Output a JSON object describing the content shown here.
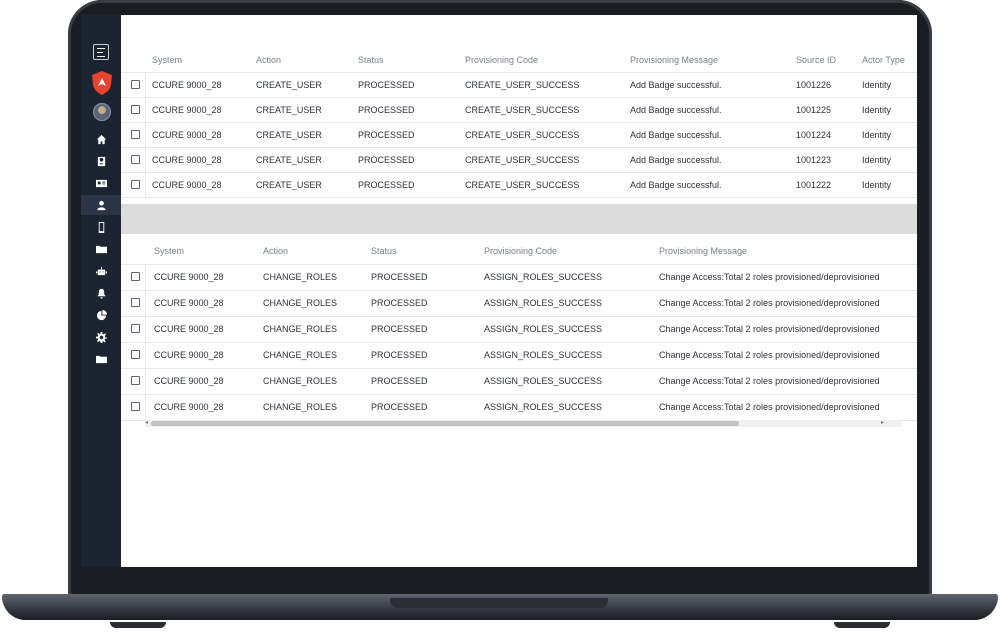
{
  "sidebar": {
    "menu_icon": "hamburger-menu-icon",
    "logo_icon": "shield-logo-icon",
    "avatar": "user-avatar",
    "nav_items": [
      {
        "icon": "home-icon"
      },
      {
        "icon": "id-badge-icon"
      },
      {
        "icon": "id-card-icon"
      },
      {
        "icon": "user-icon",
        "active": true
      },
      {
        "icon": "mobile-icon"
      },
      {
        "icon": "folder-icon"
      },
      {
        "icon": "robot-icon"
      },
      {
        "icon": "bell-icon"
      },
      {
        "icon": "pie-chart-icon"
      },
      {
        "icon": "settings-gear-icon"
      },
      {
        "icon": "folder-icon"
      }
    ],
    "accent_color": "#e8432f"
  },
  "table_top": {
    "headers": [
      "System",
      "Action",
      "Status",
      "Provisioning Code",
      "Provisioning Message",
      "Source ID",
      "Actor Type"
    ],
    "rows": [
      [
        "CCURE 9000_28",
        "CREATE_USER",
        "PROCESSED",
        "CREATE_USER_SUCCESS",
        "Add Badge successful.",
        "1001226",
        "Identity"
      ],
      [
        "CCURE 9000_28",
        "CREATE_USER",
        "PROCESSED",
        "CREATE_USER_SUCCESS",
        "Add Badge successful.",
        "1001225",
        "Identity"
      ],
      [
        "CCURE 9000_28",
        "CREATE_USER",
        "PROCESSED",
        "CREATE_USER_SUCCESS",
        "Add Badge successful.",
        "1001224",
        "Identity"
      ],
      [
        "CCURE 9000_28",
        "CREATE_USER",
        "PROCESSED",
        "CREATE_USER_SUCCESS",
        "Add Badge successful.",
        "1001223",
        "Identity"
      ],
      [
        "CCURE 9000_28",
        "CREATE_USER",
        "PROCESSED",
        "CREATE_USER_SUCCESS",
        "Add Badge successful.",
        "1001222",
        "Identity"
      ]
    ]
  },
  "table_bottom": {
    "headers": [
      "System",
      "Action",
      "Status",
      "Provisioning Code",
      "Provisioning Message"
    ],
    "rows": [
      [
        "CCURE 9000_28",
        "CHANGE_ROLES",
        "PROCESSED",
        "ASSIGN_ROLES_SUCCESS",
        "Change Access:Total 2 roles provisioned/deprovisioned"
      ],
      [
        "CCURE 9000_28",
        "CHANGE_ROLES",
        "PROCESSED",
        "ASSIGN_ROLES_SUCCESS",
        "Change Access:Total 2 roles provisioned/deprovisioned"
      ],
      [
        "CCURE 9000_28",
        "CHANGE_ROLES",
        "PROCESSED",
        "ASSIGN_ROLES_SUCCESS",
        "Change Access:Total 2 roles provisioned/deprovisioned"
      ],
      [
        "CCURE 9000_28",
        "CHANGE_ROLES",
        "PROCESSED",
        "ASSIGN_ROLES_SUCCESS",
        "Change Access:Total 2 roles provisioned/deprovisioned"
      ],
      [
        "CCURE 9000_28",
        "CHANGE_ROLES",
        "PROCESSED",
        "ASSIGN_ROLES_SUCCESS",
        "Change Access:Total 2 roles provisioned/deprovisioned"
      ],
      [
        "CCURE 9000_28",
        "CHANGE_ROLES",
        "PROCESSED",
        "ASSIGN_ROLES_SUCCESS",
        "Change Access:Total 2 roles provisioned/deprovisioned"
      ]
    ]
  }
}
